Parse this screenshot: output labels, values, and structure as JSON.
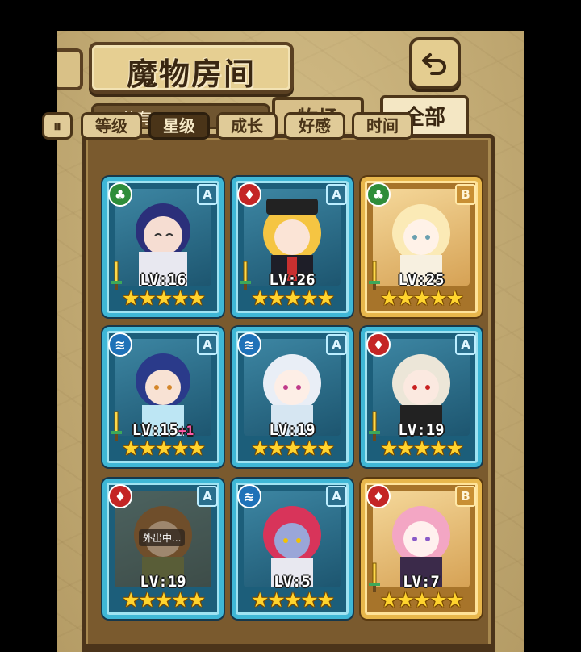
{
  "header": {
    "title": "魔物房间",
    "back_icon": "back-arrow-icon"
  },
  "summary": {
    "count_label": "共有:120"
  },
  "tabs": [
    {
      "label": "牧场",
      "active": false
    },
    {
      "label": "全部",
      "active": true
    }
  ],
  "sort": {
    "toggle_icon": "sort-order-toggle-icon",
    "options": [
      {
        "label": "等级",
        "active": false
      },
      {
        "label": "星级",
        "active": true
      },
      {
        "label": "成长",
        "active": false
      },
      {
        "label": "好感",
        "active": false
      },
      {
        "label": "时间",
        "active": false
      }
    ]
  },
  "monsters": [
    {
      "element": "grass",
      "rank": "A",
      "level": "LV:16",
      "bonus": "",
      "stars": "★★★★★",
      "weapon": true,
      "away": ""
    },
    {
      "element": "fire",
      "rank": "A",
      "level": "LV:26",
      "bonus": "",
      "stars": "★★★★★",
      "weapon": true,
      "away": ""
    },
    {
      "element": "grass",
      "rank": "B",
      "level": "LV:25",
      "bonus": "",
      "stars": "★★★★★",
      "weapon": true,
      "away": ""
    },
    {
      "element": "water",
      "rank": "A",
      "level": "LV:15",
      "bonus": "+1",
      "stars": "★★★★★",
      "weapon": true,
      "away": ""
    },
    {
      "element": "water",
      "rank": "A",
      "level": "LV:19",
      "bonus": "",
      "stars": "★★★★★",
      "weapon": false,
      "away": ""
    },
    {
      "element": "fire",
      "rank": "A",
      "level": "LV:19",
      "bonus": "",
      "stars": "★★★★★",
      "weapon": true,
      "away": ""
    },
    {
      "element": "fire",
      "rank": "A",
      "level": "LV:19",
      "bonus": "",
      "stars": "★★★★★",
      "weapon": false,
      "away": "外出中..."
    },
    {
      "element": "water",
      "rank": "A",
      "level": "LV:5",
      "bonus": "",
      "stars": "★★★★★",
      "weapon": false,
      "away": ""
    },
    {
      "element": "fire",
      "rank": "B",
      "level": "LV:7",
      "bonus": "",
      "stars": "★★★★★",
      "weapon": true,
      "away": ""
    }
  ],
  "colors": {
    "frame_a": "#3fb7d6",
    "frame_b": "#e8b74c",
    "grass": "#2f8d3a",
    "fire": "#c42525",
    "water": "#1f72b8",
    "star": "#ffd42e",
    "panel": "#7a5a2e"
  }
}
